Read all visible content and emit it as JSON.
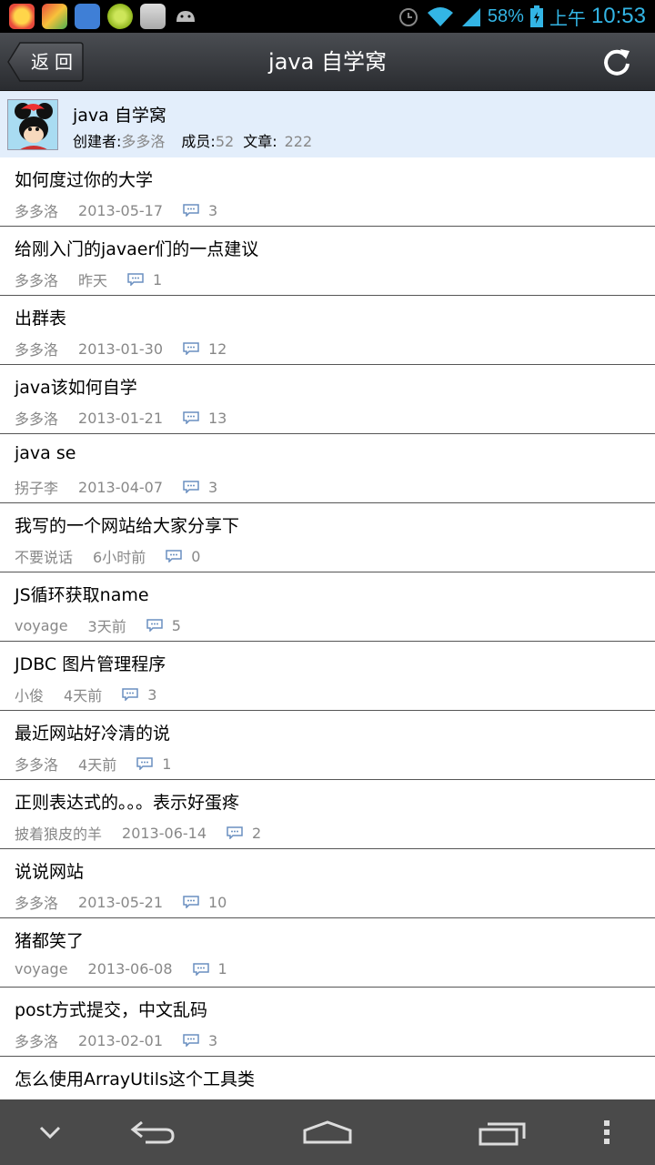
{
  "status_bar": {
    "battery": "58%",
    "ampm": "上午",
    "time": "10:53",
    "icons": [
      "app-icon-1",
      "app-icon-2",
      "app-icon-3",
      "app-icon-4",
      "app-icon-5",
      "android-icon",
      "alarm-icon",
      "wifi-icon",
      "signal-icon",
      "battery-icon"
    ]
  },
  "title_bar": {
    "back_label": "返回",
    "title": "java 自学窝"
  },
  "group": {
    "name": "java 自学窝",
    "creator_label": "创建者:",
    "creator": "多多洛",
    "members_label": "成员:",
    "members": "52",
    "posts_label": "文章:",
    "posts": "222"
  },
  "posts": [
    {
      "title": "如何度过你的大学",
      "author": "多多洛",
      "date": "2013-05-17",
      "comments": "3"
    },
    {
      "title": "给刚入门的javaer们的一点建议",
      "author": "多多洛",
      "date": "昨天",
      "comments": "1"
    },
    {
      "title": "出群表",
      "author": "多多洛",
      "date": "2013-01-30",
      "comments": "12"
    },
    {
      "title": "java该如何自学",
      "author": "多多洛",
      "date": "2013-01-21",
      "comments": "13"
    },
    {
      "title": "java se",
      "author": "拐子李",
      "date": "2013-04-07",
      "comments": "3"
    },
    {
      "title": "我写的一个网站给大家分享下",
      "author": "不要说话",
      "date": "6小时前",
      "comments": "0"
    },
    {
      "title": "JS循环获取name",
      "author": "voyage",
      "date": "3天前",
      "comments": "5"
    },
    {
      "title": "JDBC 图片管理程序",
      "author": "小俊",
      "date": "4天前",
      "comments": "3"
    },
    {
      "title": "最近网站好冷清的说",
      "author": "多多洛",
      "date": "4天前",
      "comments": "1"
    },
    {
      "title": "正则表达式的。。。表示好蛋疼",
      "author": "披着狼皮的羊",
      "date": "2013-06-14",
      "comments": "2"
    },
    {
      "title": "说说网站",
      "author": "多多洛",
      "date": "2013-05-21",
      "comments": "10"
    },
    {
      "title": "猪都笑了",
      "author": "voyage",
      "date": "2013-06-08",
      "comments": "1"
    },
    {
      "title": "post方式提交，中文乱码",
      "author": "多多洛",
      "date": "2013-02-01",
      "comments": "3"
    },
    {
      "title": "怎么使用ArrayUtils这个工具类",
      "author": "",
      "date": "",
      "comments": ""
    }
  ],
  "nav_bar": {
    "icons": [
      "hide-keyboard-icon",
      "back-icon",
      "home-icon",
      "recent-apps-icon",
      "menu-icon"
    ]
  },
  "colors": {
    "header_bg": "#e3eefb",
    "accent": "#33b5e5",
    "meta_text": "#888888"
  }
}
